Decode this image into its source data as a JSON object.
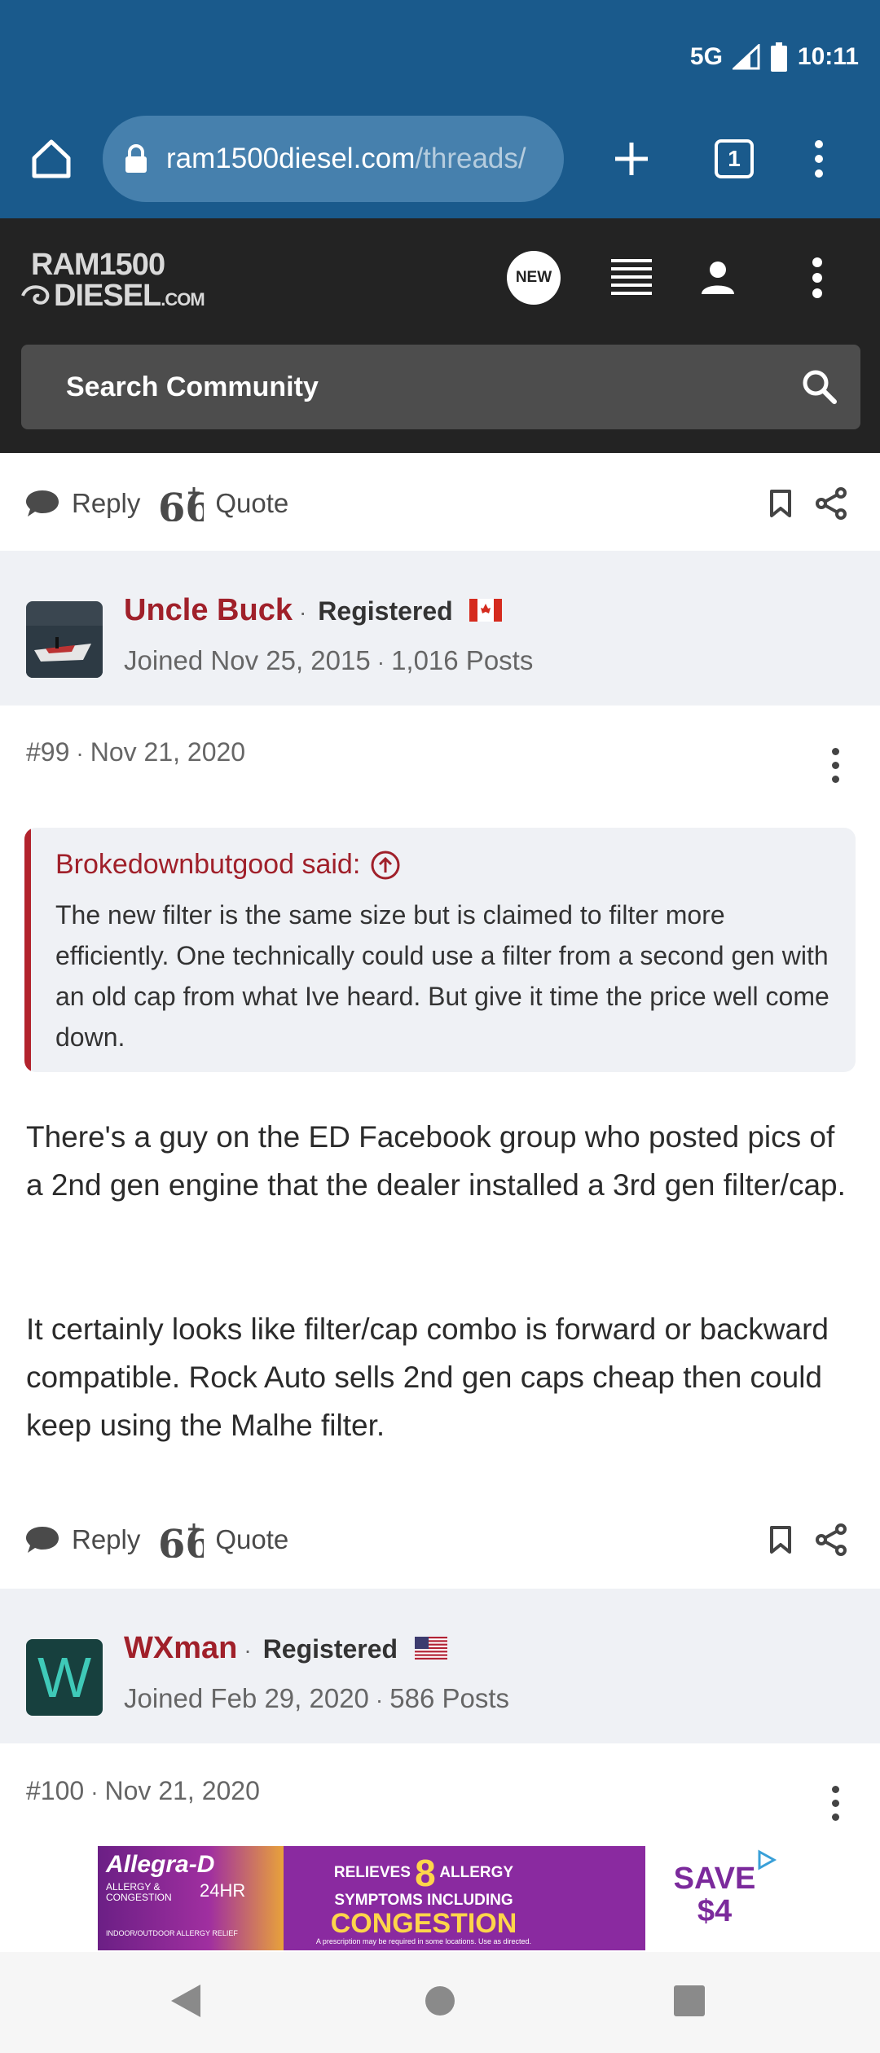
{
  "status_bar": {
    "network": "5G",
    "time": "10:11"
  },
  "browser": {
    "url_host": "ram1500diesel.com",
    "url_path": "/threads/",
    "tab_count": "1"
  },
  "site": {
    "logo_line1": "RAM1500",
    "logo_line2": "DIESEL",
    "logo_suffix": ".COM",
    "new_badge": "NEW",
    "search_placeholder": "Search Community"
  },
  "actions": {
    "reply": "Reply",
    "quote": "Quote"
  },
  "posts": [
    {
      "user": "Uncle Buck",
      "role": "Registered",
      "joined": "Joined Nov 25, 2015",
      "posts": "1,016 Posts",
      "number": "#99",
      "date": "Nov 21, 2020",
      "quote_author": "Brokedownbutgood said:",
      "quote_text": "The new filter is the same size but is claimed to filter more efficiently. One technically could use a filter from a second gen with an old cap from what Ive heard. But give it time the price well come down.",
      "paragraph1": "There's a guy on the ED Facebook group who posted pics of a 2nd gen engine that the dealer installed a 3rd gen filter/cap.",
      "paragraph2": "It certainly looks like filter/cap combo is forward or backward compatible. Rock Auto sells 2nd gen caps cheap then could keep using the Malhe filter."
    },
    {
      "user": "WXman",
      "role": "Registered",
      "avatar_letter": "W",
      "joined": "Joined Feb 29, 2020",
      "posts": "586 Posts",
      "number": "#100",
      "date": "Nov 21, 2020"
    }
  ],
  "ad": {
    "brand": "Allegra-D",
    "brand_sub1": "ALLERGY &",
    "brand_sub2": "CONGESTION",
    "hours": "24HR",
    "indoor": "INDOOR/OUTDOOR ALLERGY RELIEF",
    "line1a": "RELIEVES",
    "big_number": "8",
    "line1b": "ALLERGY",
    "line2": "SYMPTOMS INCLUDING",
    "line3": "CONGESTION",
    "disclaimer": "A prescription may be required in some locations. Use as directed.",
    "save1": "SAVE",
    "save2": "$4"
  },
  "colors": {
    "chrome_blue": "#1a5a8c",
    "site_dark": "#232323",
    "username_red": "#a0202a",
    "band_gray": "#eff1f5"
  }
}
